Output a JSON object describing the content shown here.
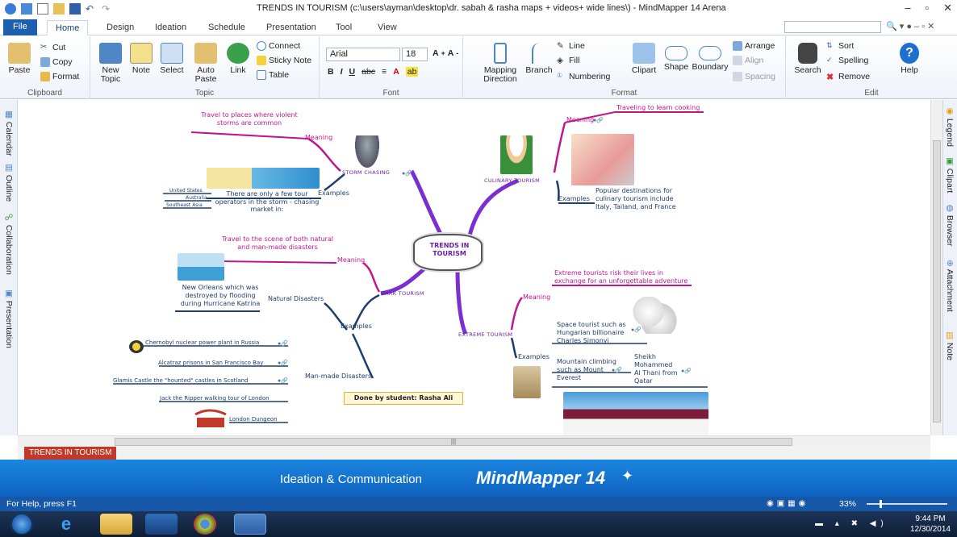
{
  "window": {
    "title": "TRENDS IN TOURISM (c:\\users\\ayman\\desktop\\dr. sabah & rasha maps + videos+ wide lines\\) - MindMapper 14 Arena"
  },
  "tabs": [
    "File",
    "Home",
    "Design",
    "Ideation",
    "Schedule",
    "Presentation",
    "Tool",
    "View"
  ],
  "ribbon": {
    "clipboard": {
      "paste": "Paste",
      "cut": "Cut",
      "copy": "Copy",
      "format": "Format",
      "label": "Clipboard"
    },
    "topic": {
      "new_topic": "New Topic",
      "note": "Note",
      "select": "Select",
      "auto_paste": "Auto Paste",
      "link": "Link",
      "connect": "Connect",
      "sticky": "Sticky Note",
      "table": "Table",
      "label": "Topic"
    },
    "font": {
      "family": "Arial",
      "size": "18",
      "label": "Font"
    },
    "format": {
      "mapping": "Mapping Direction",
      "branch": "Branch",
      "line": "Line",
      "fill": "Fill",
      "numbering": "Numbering",
      "clipart": "Clipart",
      "shape": "Shape",
      "boundary": "Boundary",
      "arrange": "Arrange",
      "align": "Align",
      "spacing": "Spacing",
      "label": "Format"
    },
    "edit": {
      "search": "Search",
      "sort": "Sort",
      "spelling": "Spelling",
      "remove": "Remove",
      "help": "Help",
      "label": "Edit"
    }
  },
  "sidebar_left": [
    "Calendar",
    "Outline",
    "Collaboration",
    "Presentation"
  ],
  "sidebar_right": [
    "Legend",
    "Clipart",
    "Browser",
    "Attachment",
    "Note"
  ],
  "map": {
    "center": "TRENDS IN TOURISM",
    "storm": {
      "branch": "STORM CHASING",
      "meaning_label": "Meaning",
      "meaning": "Travel to places where violent storms are common",
      "examples_label": "Examples",
      "example_text": "There are only a few tour operators in the storm - chasing market in:",
      "countries": [
        "United States",
        "Australia",
        "Southeast Asia"
      ]
    },
    "dark": {
      "branch": "DARK TOURISM",
      "meaning_label": "Meaning",
      "meaning": "Travel to the scene of both natural and man-made disasters",
      "examples_label": "Examples",
      "natural_label": "Natural Disasters",
      "natural_example": "New Orleans which was destroyed by flooding during Hurricane Katrina",
      "manmade_label": "Man-made Disasters",
      "manmade": [
        "Chernobyl nuclear power plant in Russia",
        "Alcatraz prisons in San Francisco Bay",
        "Glamis Castle  the \"hounted\"  castles in Scotland",
        "Jack the Ripper walking tour of London",
        "London Dungeon"
      ]
    },
    "culinary": {
      "branch": "CULINARY TOURISM",
      "meaning_label": "Meaning",
      "meaning": "Traveling to learn cooking",
      "examples_label": "Examples",
      "example_text": "Popular destinations for culinary tourism include Italy, Tailand, and France"
    },
    "extreme": {
      "branch": "EXTREME TOURISM",
      "meaning_label": "Meaning",
      "meaning": "Extreme tourists risk their lives in exchange for an unforgettable adventure",
      "examples_label": "Examples",
      "examples": [
        "Space tourist such as Hungarian billionaire Charles Simonyi",
        "Mountain climbing such as Mount Everest",
        "Sheikh Mohammed Al Thani from Qatar"
      ]
    },
    "credit": "Done by student: Rasha Ali"
  },
  "sheet_tab": "TRENDS IN TOURISM",
  "banner": {
    "text": "Ideation & Communication",
    "brand": "MindMapper 14"
  },
  "status": {
    "help": "For Help, press F1",
    "zoom": "33%"
  },
  "clock": {
    "time": "9:44 PM",
    "date": "12/30/2014"
  },
  "colors": {
    "magenta": "#c0168c",
    "purple": "#7a2fd0",
    "navy": "#1f3d6b",
    "ribbon_blue": "#1f5fb0"
  }
}
